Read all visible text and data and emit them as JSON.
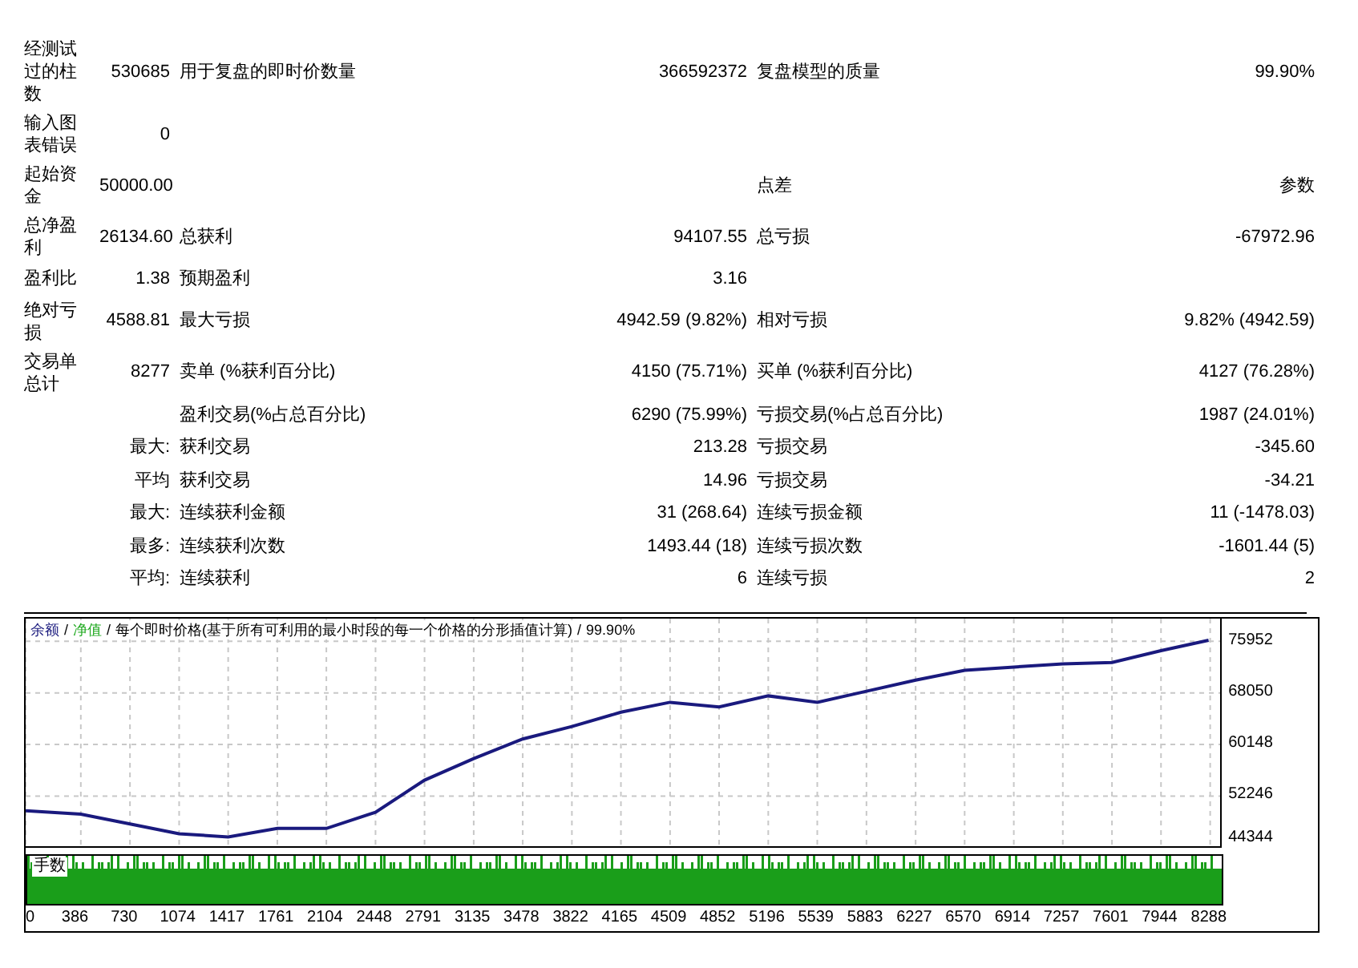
{
  "report": {
    "rows": [
      {
        "column_1": "经测试过的柱数",
        "column_2": "530685",
        "column_3": "用于复盘的即时价数量",
        "column_4": "366592372",
        "column_5": "复盘模型的质量",
        "column_6": "99.90%"
      },
      {
        "column_1": "输入图表错误",
        "column_2": "0"
      },
      {
        "column_1": "起始资金",
        "column_2": "50000.00",
        "column_5": "点差",
        "column_6": "参数"
      },
      {
        "column_1": "总净盈利",
        "column_2": "26134.60",
        "column_3": "总获利",
        "column_4": "94107.55",
        "column_5": "总亏损",
        "column_6": "-67972.96"
      },
      {
        "column_1": "盈利比",
        "column_2": "1.38",
        "column_3": "预期盈利",
        "column_4": "3.16"
      },
      {
        "column_1": "绝对亏损",
        "column_2": "4588.81",
        "column_3": "最大亏损",
        "column_4": "4942.59 (9.82%)",
        "column_5": "相对亏损",
        "column_6": "9.82% (4942.59)"
      },
      {
        "column_1": "交易单总计",
        "column_2": "8277",
        "column_3": "卖单 (%获利百分比)",
        "column_4": "4150 (75.71%)",
        "column_5": "买单 (%获利百分比)",
        "column_6": "4127 (76.28%)"
      },
      {
        "column_3": "盈利交易(%占总百分比)",
        "column_4": "6290 (75.99%)",
        "column_5": "亏损交易(%占总百分比)",
        "column_6": "1987 (24.01%)"
      },
      {
        "column_2": "最大:",
        "column_3": "获利交易",
        "column_4": "213.28",
        "column_5": "亏损交易",
        "column_6": "-345.60"
      },
      {
        "column_2": "平均",
        "column_3": "获利交易",
        "column_4": "14.96",
        "column_5": "亏损交易",
        "column_6": "-34.21"
      },
      {
        "column_2": "最大:",
        "column_3": "连续获利金额",
        "column_4": "31 (268.64)",
        "column_5": "连续亏损金额",
        "column_6": "11 (-1478.03)"
      },
      {
        "column_2": "最多:",
        "column_3": "连续获利次数",
        "column_4": "1493.44 (18)",
        "column_5": "连续亏损次数",
        "column_6": "-1601.44 (5)"
      },
      {
        "column_2": "平均:",
        "column_3": "连续获利",
        "column_4": "6",
        "column_5": "连续亏损",
        "column_6": "2"
      }
    ]
  },
  "chart": {
    "legend": [
      {
        "text": "/"
      },
      {
        "text": "净值",
        "color": "#22aa22"
      },
      {
        "text": "/"
      },
      {
        "text": "每个即时价格(基于所有可利用的最小时段的每一个价格的分形插值计算)"
      },
      {
        "text": "/"
      },
      {
        "text": "99.90%"
      }
    ],
    "volume_label": "手数",
    "chart_data": {
      "type": "line",
      "x": [
        0,
        386,
        730,
        1074,
        1417,
        1761,
        2104,
        2448,
        2791,
        3135,
        3478,
        3822,
        4165,
        4509,
        4852,
        5196,
        5539,
        5883,
        6227,
        6570,
        6914,
        7257,
        7601,
        7944,
        8277
      ],
      "series": [
        {
          "name": "余额",
          "color": "#1a1a7e",
          "values": [
            50000,
            49500,
            48000,
            46500,
            46000,
            47300,
            47300,
            49800,
            54700,
            58000,
            61000,
            62900,
            65100,
            66600,
            65900,
            67600,
            66600,
            68300,
            70000,
            71500,
            72000,
            72500,
            72700,
            74500,
            76100
          ]
        }
      ],
      "grid": true,
      "xlim": [
        0,
        8380
      ],
      "ylim": [
        44344,
        79410
      ],
      "xticks": [
        0,
        386,
        730,
        1074,
        1417,
        1761,
        2104,
        2448,
        2791,
        3135,
        3478,
        3822,
        4165,
        4509,
        4852,
        5196,
        5539,
        5883,
        6227,
        6570,
        6914,
        7257,
        7601,
        7944,
        8288
      ],
      "yticks": [
        44344,
        52246,
        60148,
        68050,
        75952
      ]
    }
  }
}
